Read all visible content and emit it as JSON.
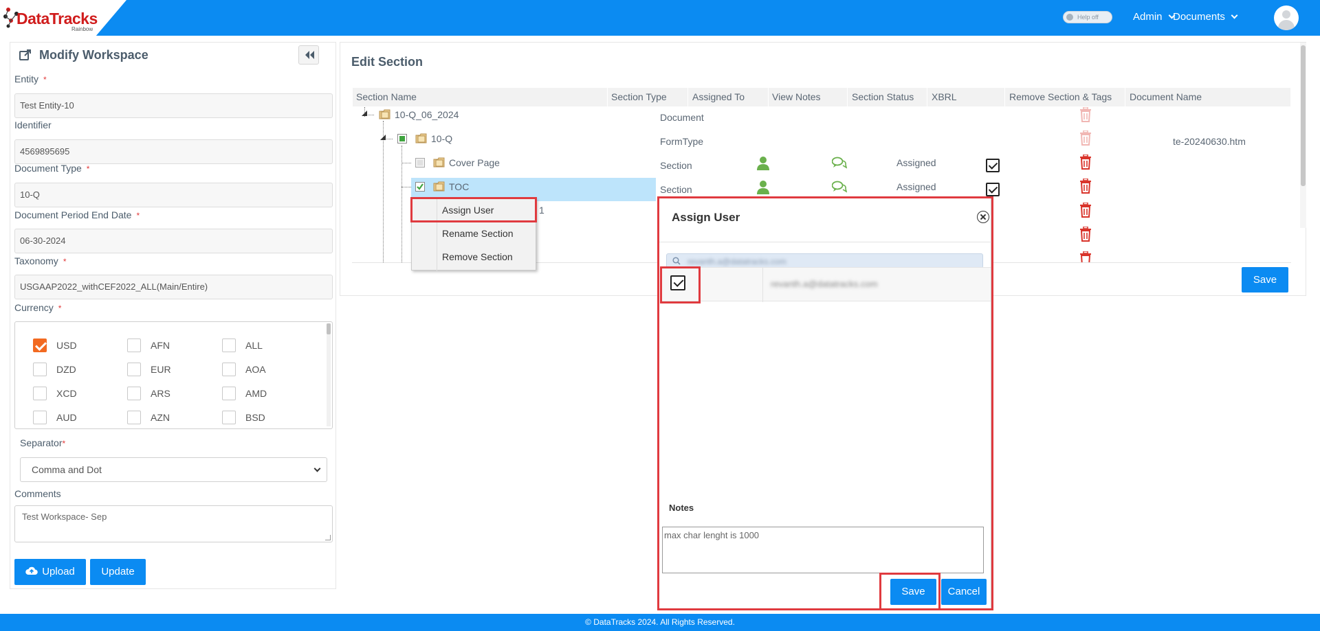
{
  "header": {
    "logo_text": "DataTracks",
    "logo_sub": "Rainbow",
    "help_toggle": "Help off",
    "nav_admin": "Admin",
    "nav_documents": "Documents"
  },
  "left_panel": {
    "title": "Modify Workspace",
    "fields": {
      "entity": {
        "label": "Entity",
        "value": "Test Entity-10"
      },
      "identifier": {
        "label": "Identifier",
        "value": "4569895695"
      },
      "document_type": {
        "label": "Document Type",
        "value": "10-Q"
      },
      "period_end": {
        "label": "Document Period End Date",
        "value": "06-30-2024"
      },
      "taxonomy": {
        "label": "Taxonomy",
        "value": "USGAAP2022_withCEF2022_ALL(Main/Entire)"
      }
    },
    "currency": {
      "label": "Currency",
      "items": [
        {
          "code": "USD",
          "checked": true
        },
        {
          "code": "AFN",
          "checked": false
        },
        {
          "code": "ALL",
          "checked": false
        },
        {
          "code": "DZD",
          "checked": false
        },
        {
          "code": "EUR",
          "checked": false
        },
        {
          "code": "AOA",
          "checked": false
        },
        {
          "code": "XCD",
          "checked": false
        },
        {
          "code": "ARS",
          "checked": false
        },
        {
          "code": "AMD",
          "checked": false
        },
        {
          "code": "AUD",
          "checked": false
        },
        {
          "code": "AZN",
          "checked": false
        },
        {
          "code": "BSD",
          "checked": false
        }
      ]
    },
    "separator": {
      "label": "Separator",
      "value": "Comma and Dot"
    },
    "comments": {
      "label": "Comments",
      "value": "Test Workspace- Sep"
    },
    "upload_label": "Upload",
    "update_label": "Update"
  },
  "edit_section": {
    "title": "Edit Section",
    "columns": [
      "Section Name",
      "Section Type",
      "Assigned To",
      "View Notes",
      "Section Status",
      "XBRL",
      "Remove Section & Tags",
      "Document Name"
    ],
    "rows": [
      {
        "name": "10-Q_06_2024",
        "type": "Document",
        "status": "",
        "document": ""
      },
      {
        "name": "10-Q",
        "type": "FormType",
        "status": "",
        "document": "te-20240630.htm"
      },
      {
        "name": "Cover Page",
        "type": "Section",
        "status": "Assigned",
        "document": ""
      },
      {
        "name": "TOC",
        "type": "Section",
        "status": "Assigned",
        "document": ""
      }
    ],
    "hidden_row_fragment": "1",
    "save_label": "Save"
  },
  "context_menu": {
    "items": [
      "Assign User",
      "Rename Section",
      "Remove Section"
    ]
  },
  "assign_user_modal": {
    "title": "Assign User",
    "search_value": "revanth.a@datatracks.com",
    "user_email": "revanth.a@datatracks.com",
    "notes_label": "Notes",
    "notes_placeholder": "max char lenght is 1000",
    "save_label": "Save",
    "cancel_label": "Cancel"
  },
  "footer": {
    "text": "© DataTracks 2024. All Rights Reserved."
  },
  "colors": {
    "primary": "#0b8bf2",
    "highlight": "#e03a3f",
    "checked_orange": "#f26a21",
    "trash_red": "#d9342b",
    "user_green": "#6ab04c"
  }
}
